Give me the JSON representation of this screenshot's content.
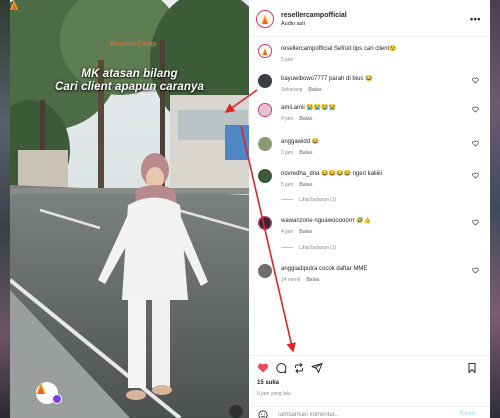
{
  "video": {
    "watermark": "ResellerCamp",
    "caption_line1": "MK atasan bilang",
    "caption_line2": "Cari client apapun caranya"
  },
  "header": {
    "username": "resellercampofficial",
    "audio": "Audio asli"
  },
  "comments": [
    {
      "user": "resellercampofficial",
      "text": "Sefruit tips cari client😉",
      "time": "5 jam",
      "reply": "",
      "avatar": "brand"
    },
    {
      "user": "bayuwibowo7777",
      "text": "parah di bius 😂",
      "time": "Sekarang",
      "reply": "Balas",
      "avatar": "dark"
    },
    {
      "user": "amii.amii",
      "text": "😭😭😭😭",
      "time": "4 jam",
      "reply": "Balas",
      "avatar": "ring"
    },
    {
      "user": "anggawidd",
      "text": "😂",
      "time": "3 jam",
      "reply": "Balas",
      "avatar": "green"
    },
    {
      "user": "novredha_dna",
      "text": "😂😂😂😂 ngeri kaliiiii",
      "time": "5 jam",
      "reply": "Balas",
      "avatar": "forest"
    },
    {
      "user": "wawanzone",
      "text": "nguawooooorrr 🤣👍",
      "time": "4 jam",
      "reply": "Balas",
      "avatar": "ring2"
    },
    {
      "user": "anggiadiputra",
      "text": "cocok daftar MME",
      "time": "14 menit",
      "reply": "Balas",
      "avatar": "gray"
    }
  ],
  "view_replies": [
    "Lihat balasan (1)",
    "Lihat balasan (1)"
  ],
  "actions": {
    "likes": "15 suka",
    "time_ago": "5 jam yang lalu",
    "comment_placeholder": "Tambahkan komentar...",
    "post_label": "Kirim"
  },
  "colors": {
    "heart": "#ed4956",
    "arrow": "#e0222a",
    "post_disabled": "#b2dffc"
  }
}
